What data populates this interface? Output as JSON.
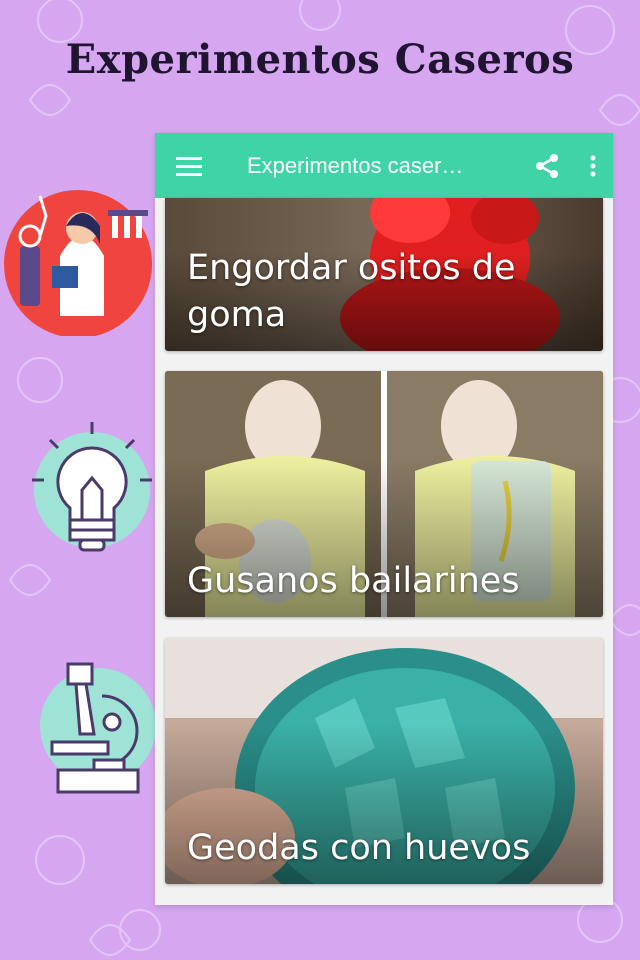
{
  "promo": {
    "title": "Experimentos Caseros"
  },
  "appbar": {
    "title": "Experimentos caser…",
    "menu_icon": "hamburger-menu-icon",
    "share_icon": "share-icon",
    "overflow_icon": "more-vert-icon"
  },
  "experiments": [
    {
      "title": "Engordar ositos de goma"
    },
    {
      "title": "Gusanos bailarines"
    },
    {
      "title": "Geodas con huevos"
    }
  ],
  "colors": {
    "background": "#d6a7f0",
    "appbar": "#3fd3a6",
    "accent_circle": "#f0453f",
    "mint_circle": "#9fe3d6"
  }
}
